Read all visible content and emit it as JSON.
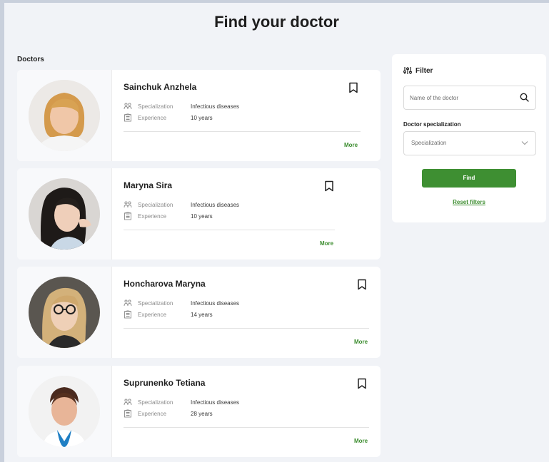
{
  "page": {
    "title": "Find your doctor",
    "section_label": "Doctors"
  },
  "doctors": [
    {
      "name": "Sainchuk Anzhela",
      "specialization_label": "Specialization",
      "specialization": "Infectious diseases",
      "experience_label": "Experience",
      "experience": "10 years",
      "more_label": "More"
    },
    {
      "name": "Maryna Sira",
      "specialization_label": "Specialization",
      "specialization": "Infectious diseases",
      "experience_label": "Experience",
      "experience": "10 years",
      "more_label": "More"
    },
    {
      "name": "Honcharova Maryna",
      "specialization_label": "Specialization",
      "specialization": "Infectious diseases",
      "experience_label": "Experience",
      "experience": "14 years",
      "more_label": "More"
    },
    {
      "name": "Suprunenko Tetiana",
      "specialization_label": "Specialization",
      "specialization": "Infectious diseases",
      "experience_label": "Experience",
      "experience": "28 years",
      "more_label": "More"
    }
  ],
  "filter": {
    "title": "Filter",
    "search_placeholder": "Name of the doctor",
    "specialization_label": "Doctor specialization",
    "specialization_placeholder": "Specialization",
    "find_label": "Find",
    "reset_label": "Reset filters"
  },
  "icons": {
    "bookmark": "bookmark-icon",
    "specialization": "people-icon",
    "experience": "building-icon",
    "search": "search-icon",
    "filter": "sliders-icon",
    "dropdown": "chevron-down-icon"
  },
  "colors": {
    "accent": "#3e8f32",
    "background": "#f1f3f7",
    "card": "#ffffff"
  }
}
